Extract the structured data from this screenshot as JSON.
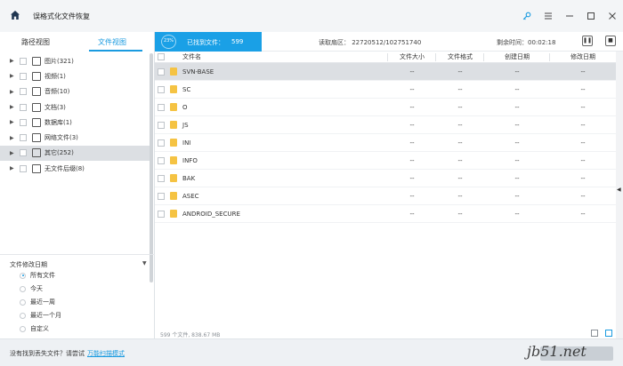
{
  "app": {
    "title": "误格式化文件恢复"
  },
  "window_controls": [
    "key-icon",
    "menu-icon",
    "minimize-icon",
    "maximize-icon",
    "close-icon"
  ],
  "left": {
    "tabs": {
      "path": "路径视图",
      "file": "文件视图"
    },
    "tree": [
      {
        "label": "图片(321)",
        "icon": "image-icon",
        "selected": false
      },
      {
        "label": "视频(1)",
        "icon": "video-icon",
        "selected": false
      },
      {
        "label": "音频(10)",
        "icon": "audio-icon",
        "selected": false
      },
      {
        "label": "文档(3)",
        "icon": "document-icon",
        "selected": false
      },
      {
        "label": "数据库(1)",
        "icon": "database-icon",
        "selected": false
      },
      {
        "label": "网络文件(3)",
        "icon": "globe-icon",
        "selected": false
      },
      {
        "label": "其它(252)",
        "icon": "other-icon",
        "selected": true
      },
      {
        "label": "无文件后缀(8)",
        "icon": "blank-file-icon",
        "selected": false
      }
    ],
    "filter": {
      "title": "文件修改日期",
      "options": [
        "所有文件",
        "今天",
        "最近一周",
        "最近一个月",
        "自定义"
      ],
      "selected_index": 0
    }
  },
  "status": {
    "progress_label": "23%",
    "found_label": "已找到文件：",
    "found_count": "599",
    "sector": "读取扇区：  22720512/102751740",
    "remaining": "剩余时间：00:02:18"
  },
  "table": {
    "headers": {
      "name": "文件名",
      "size": "文件大小",
      "type": "文件格式",
      "created": "创建日期",
      "modified": "修改日期"
    },
    "rows": [
      {
        "name": "SVN-BASE",
        "size": "--",
        "type": "--",
        "created": "--",
        "modified": "--"
      },
      {
        "name": "SC",
        "size": "--",
        "type": "--",
        "created": "--",
        "modified": "--"
      },
      {
        "name": "O",
        "size": "--",
        "type": "--",
        "created": "--",
        "modified": "--"
      },
      {
        "name": "JS",
        "size": "--",
        "type": "--",
        "created": "--",
        "modified": "--"
      },
      {
        "name": "INI",
        "size": "--",
        "type": "--",
        "created": "--",
        "modified": "--"
      },
      {
        "name": "INFO",
        "size": "--",
        "type": "--",
        "created": "--",
        "modified": "--"
      },
      {
        "name": "BAK",
        "size": "--",
        "type": "--",
        "created": "--",
        "modified": "--"
      },
      {
        "name": "ASEC",
        "size": "--",
        "type": "--",
        "created": "--",
        "modified": "--"
      },
      {
        "name": "ANDROID_SECURE",
        "size": "--",
        "type": "--",
        "created": "--",
        "modified": "--"
      }
    ],
    "summary": "599 个文件, 838.67 MB"
  },
  "footer": {
    "prompt": "没有找到丢失文件？请尝试",
    "link": "万能扫描模式"
  },
  "watermark": "jb51.net",
  "colors": {
    "accent": "#1a9be0",
    "folder": "#f5c343",
    "selected_row": "#dcdfe3"
  }
}
